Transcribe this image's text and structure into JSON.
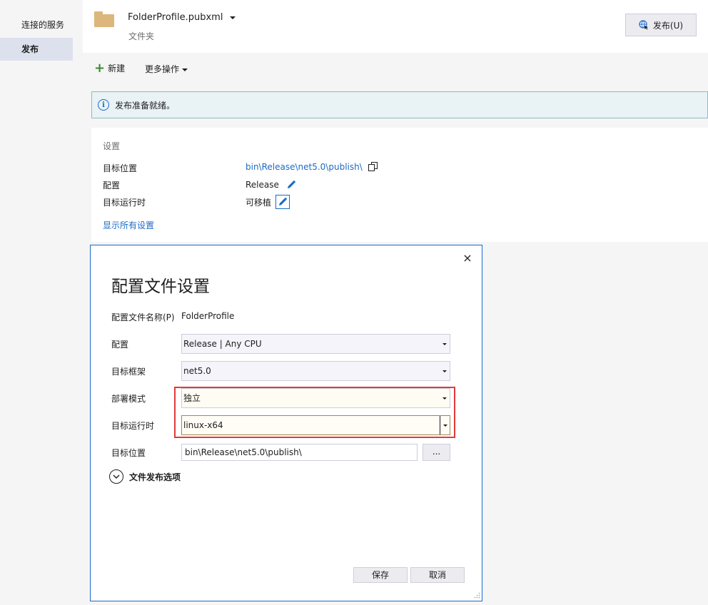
{
  "nav": {
    "items": [
      {
        "label": "连接的服务",
        "active": false
      },
      {
        "label": "发布",
        "active": true
      }
    ]
  },
  "header": {
    "profile_name": "FolderProfile.pubxml",
    "profile_type": "文件夹",
    "publish_button": "发布(U)"
  },
  "toolbar": {
    "new_label": "新建",
    "more_label": "更多操作"
  },
  "info": {
    "message": "发布准备就绪。"
  },
  "settings": {
    "title": "设置",
    "rows": [
      {
        "label": "目标位置",
        "value": "bin\\Release\\net5.0\\publish\\"
      },
      {
        "label": "配置",
        "value": "Release"
      },
      {
        "label": "目标运行时",
        "value": "可移植"
      }
    ],
    "show_all_link": "显示所有设置"
  },
  "dialog": {
    "title": "配置文件设置",
    "close_glyph": "×",
    "profile_name_label": "配置文件名称(P)",
    "profile_name_value": "FolderProfile",
    "fields": [
      {
        "label": "配置",
        "value": "Release | Any CPU"
      },
      {
        "label": "目标框架",
        "value": "net5.0"
      },
      {
        "label": "部署模式",
        "value": "独立"
      },
      {
        "label": "目标运行时",
        "value": "linux-x64"
      }
    ],
    "target_location_label": "目标位置",
    "target_location_value": "bin\\Release\\net5.0\\publish\\",
    "browse_label": "...",
    "expander_label": "文件发布选项",
    "save_label": "保存",
    "cancel_label": "取消"
  },
  "colors": {
    "accent": "#1b6ac9",
    "highlight": "#e23a3a",
    "info_bg": "#e9f2f4",
    "folder": "#dcb67a"
  }
}
